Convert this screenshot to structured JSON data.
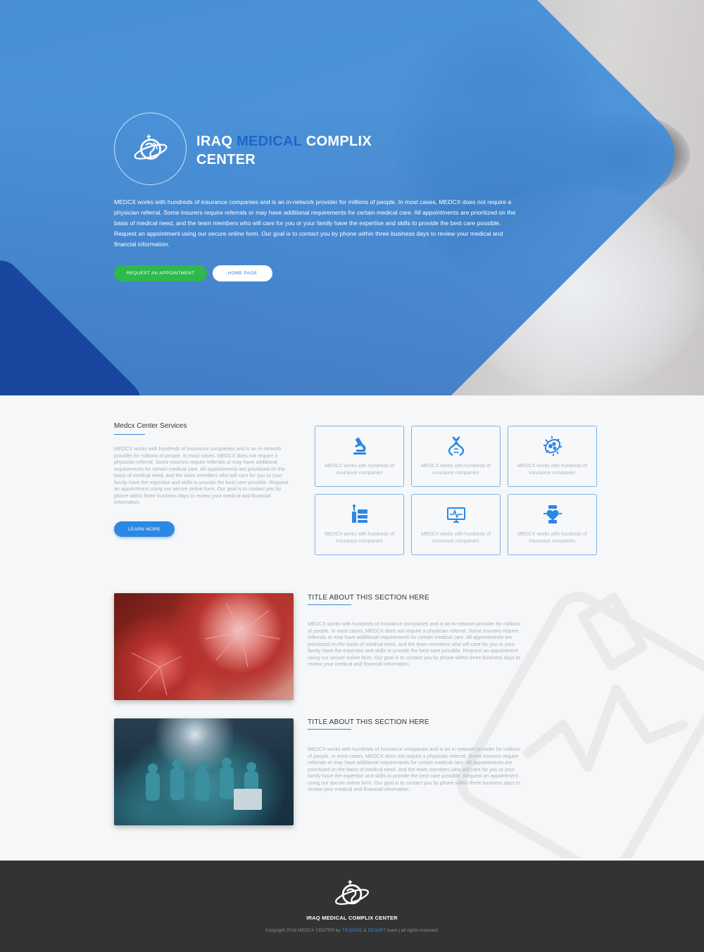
{
  "hero": {
    "title_part1": "IRAQ ",
    "title_accent": "MEDICAL",
    "title_part2": " COMPLIX",
    "title_line2": "CENTER",
    "description": "MEDCX works with hundreds of insurance companies and is an in-network provider for millions of people. In most cases, MEDCX does not require a physician referral. Some insurers require referrals or may have additional requirements for certain medical care. All appointments are prioritized on the basis of medical need, and the team members who will care for you or your family have the expertise and skills to provide the best care possible. Request an appointment using our secure online form. Our goal is to contact you by phone within three business days to review your medical and financial information.",
    "btn_appointment": "REQUEST AN APPOINTMENT",
    "btn_home": "HOME PAGE"
  },
  "services": {
    "title": "Medcx Center Services",
    "description": "MEDCX works with hundreds of insurance companies and is an in-network provider for millions of people. In most cases, MEDCX does not require a physician referral. Some insurers require referrals or may have additional requirements for certain medical care. All appointments are prioritized on the basis of medical need, and the team members who will care for you or your family have the expertise and skills to provide the best care possible. Request an appointment using our secure online form. Our goal is to contact you by phone within three business days to review your medical and financial information.",
    "btn_learn": "LEARN MORE",
    "cards": [
      {
        "icon": "microscope-icon",
        "text": "MEDCX works with hundreds of insurance companies"
      },
      {
        "icon": "dna-icon",
        "text": "MEDCX works with hundreds of insurance companies"
      },
      {
        "icon": "bacteria-icon",
        "text": "MEDCX works with hundreds of insurance companies"
      },
      {
        "icon": "lab-equipment-icon",
        "text": "MEDCX works with hundreds of insurance companies"
      },
      {
        "icon": "heart-monitor-icon",
        "text": "MEDCX works with hundreds of insurance companies"
      },
      {
        "icon": "heart-scale-icon",
        "text": "MEDCX works with hundreds of insurance companies"
      }
    ]
  },
  "about": [
    {
      "title": "TITLE ABOUT THIS SECTION HERE",
      "text": "MEDCX works with hundreds of insurance companies and is an in-network provider for millions of people. In most cases, MEDCX does not require a physician referral. Some insurers require referrals or may have additional requirements for certain medical care. All appointments are prioritized on the basis of medical need, and the team members who will care for you or your family have the expertise and skills to provide the best care possible. Request an appointment using our secure online form. Our goal is to contact you by phone within three business days to review your medical and financial information."
    },
    {
      "title": "TITLE ABOUT THIS SECTION HERE",
      "text": "MEDCX works with hundreds of insurance companies and is an in-network provider for millions of people. In most cases, MEDCX does not require a physician referral. Some insurers require referrals or may have additional requirements for certain medical care. All appointments are prioritized on the basis of medical need, and the team members who will care for you or your family have the expertise and skills to provide the best care possible. Request an appointment using our secure online form. Our goal is to contact you by phone within three business days to review your medical and financial information."
    }
  ],
  "footer": {
    "name": "IRAQ MEDICAL COMPLIX CENTER",
    "copy_prefix": "Copyright 2018 MEDCX CENTER by ",
    "link1": "TIEQODE",
    "copy_and": " & ",
    "link2": "DEVART",
    "copy_suffix": " team | all rights reserved."
  },
  "colors": {
    "accent": "#3a86d8",
    "green": "#2fb84b",
    "footer_bg": "#333333"
  }
}
